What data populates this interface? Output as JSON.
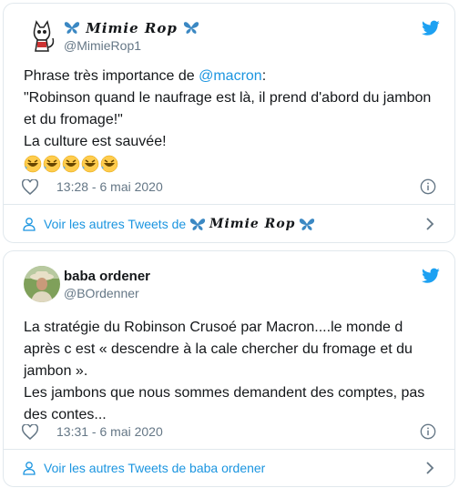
{
  "colors": {
    "link": "#1b95e0",
    "secondary": "#657786",
    "border": "#e1e8ed",
    "twitter_blue": "#1da1f2",
    "text": "#14171a"
  },
  "tweets": [
    {
      "display_name": "Mimie Rop",
      "handle": "@MimieRop1",
      "avatar_icon": "cat-avatar-icon",
      "text_prefix": "Phrase très importance de ",
      "mention": "@macron",
      "text_suffix": ":\n\"Robinson quand le naufrage est là, il prend d'abord du jambon et du fromage!\"\nLa culture est sauvée!",
      "emoji_icon": "rolling-laughing-emoji-icon",
      "emoji_count": "5",
      "timestamp": "13:28 - 6 mai 2020",
      "footer_label": "Voir les autres Tweets de",
      "footer_name": "Mimie Rop"
    },
    {
      "display_name": "baba ordener",
      "handle": "@BOrdenner",
      "avatar_icon": "profile-photo-avatar",
      "text": "La stratégie du Robinson Crusoé par Macron....le monde d après c est « descendre à la cale chercher du fromage et du jambon ».\nLes jambons que nous sommes demandent des comptes, pas des contes...",
      "timestamp": "13:31 - 6 mai 2020",
      "footer_label": "Voir les autres Tweets de baba ordener"
    }
  ]
}
